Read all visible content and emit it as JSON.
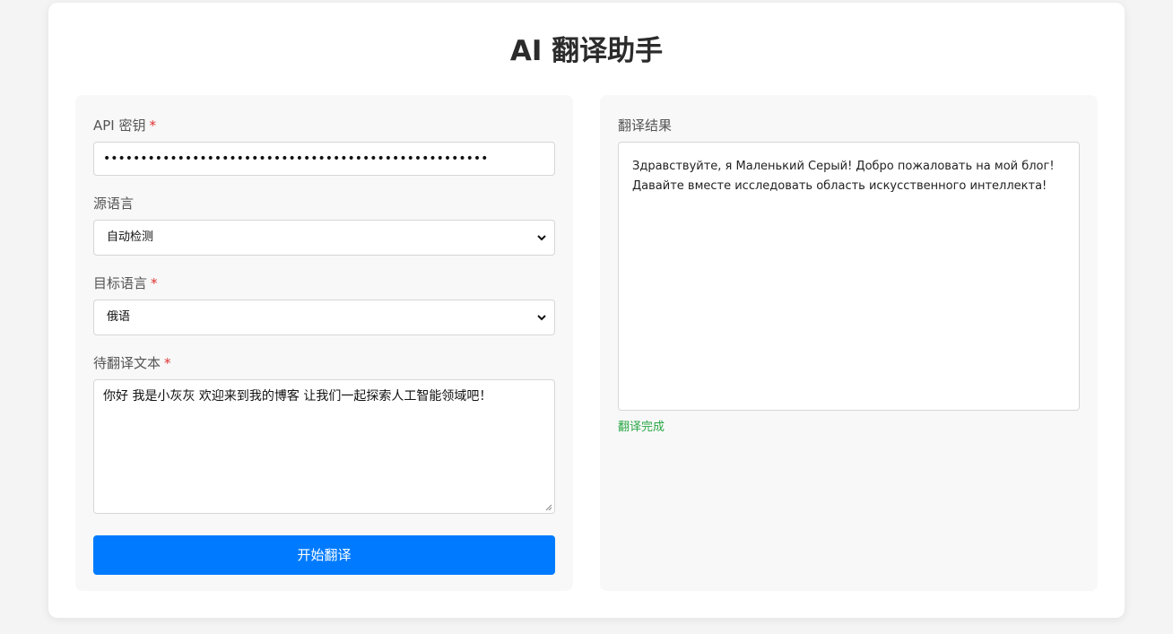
{
  "app": {
    "title": "AI 翻译助手"
  },
  "form": {
    "api_key": {
      "label": "API 密钥",
      "required_mark": "*",
      "value_masked": "••••••••••••••••••••••••••••••••••••••••••••••••••••"
    },
    "source_lang": {
      "label": "源语言",
      "selected": "自动检测"
    },
    "target_lang": {
      "label": "目标语言",
      "required_mark": "*",
      "selected": "俄语"
    },
    "text": {
      "label": "待翻译文本",
      "required_mark": "*",
      "value": "你好 我是小灰灰 欢迎来到我的博客 让我们一起探索人工智能领域吧！"
    },
    "submit_label": "开始翻译"
  },
  "result": {
    "label": "翻译结果",
    "text": "Здравствуйте, я Маленький Серый! Добро пожаловать на мой блог! Давайте вместе исследовать область искусственного интеллекта!",
    "status": "翻译完成"
  },
  "colors": {
    "accent": "#007bff",
    "required": "#e03131",
    "success": "#28a745"
  }
}
